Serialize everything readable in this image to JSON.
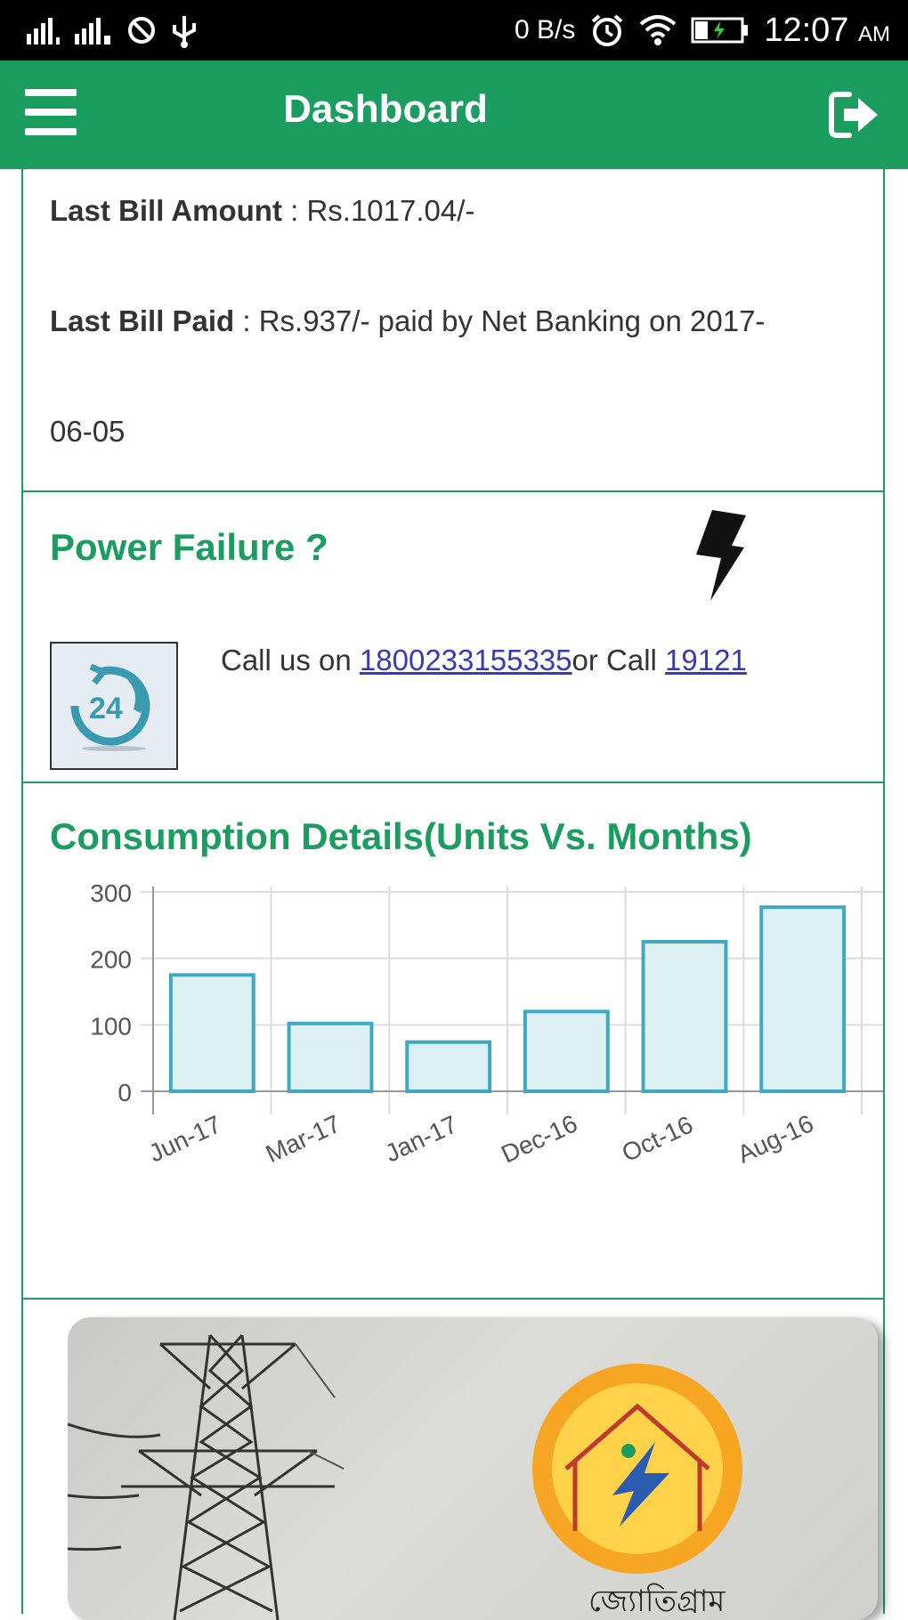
{
  "status_bar": {
    "network_speed": "0 B/s",
    "time": "12:07",
    "ampm": "AM",
    "icons": [
      "signal-sim1-icon",
      "signal-sim2-icon",
      "do-not-disturb-icon",
      "usb-icon",
      "alarm-icon",
      "wifi-icon",
      "battery-charging-icon"
    ]
  },
  "app_bar": {
    "title": "Dashboard",
    "menu_icon": "hamburger-menu-icon",
    "logout_icon": "logout-icon"
  },
  "bill": {
    "last_amount_label": "Last Bill Amount",
    "last_amount_value": " : Rs.1017.04/-",
    "last_paid_label": "Last Bill Paid",
    "last_paid_value_line1": " : Rs.937/- paid by Net Banking on 2017-",
    "last_paid_value_line2": "06-05"
  },
  "power_failure": {
    "title": "Power Failure ?",
    "call_prefix": "Call us on ",
    "phone_1": "1800233155335",
    "call_middle": "or Call ",
    "phone_2": "19121",
    "support_icon_text": "24"
  },
  "consumption": {
    "title": "Consumption Details(Units Vs. Months)"
  },
  "chart_data": {
    "type": "bar",
    "categories": [
      "Jun-17",
      "Mar-17",
      "Jan-17",
      "Dec-16",
      "Oct-16",
      "Aug-16"
    ],
    "values": [
      175,
      102,
      74,
      120,
      225,
      277
    ],
    "ylim": [
      0,
      300
    ],
    "yticks": [
      0,
      100,
      200,
      300
    ],
    "grid": true,
    "bar_fill": "#dcf0f3",
    "bar_stroke": "#3fa9c4"
  },
  "banner": {
    "logo_script": "জ্যোতিগ্রাম"
  },
  "colors": {
    "primary": "#1b9d5f",
    "link": "#3a3ab8"
  }
}
